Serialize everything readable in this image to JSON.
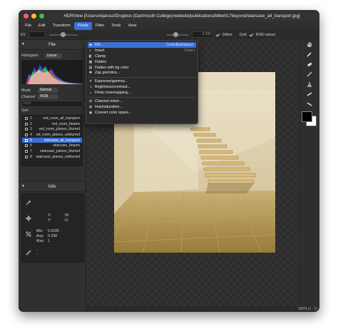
{
  "window": {
    "title": "HDRView [/Users/wjarosz/Dropbox (Dartmouth College)/website/publications/bitterli17beyond/staircase_all_transport.jpg]"
  },
  "menubar": [
    "File",
    "Edit",
    "Transform",
    "Pixels",
    "Filter",
    "Tools",
    "View"
  ],
  "toolbar": {
    "ev_label": "EV",
    "gamma_value": "2.200",
    "dither_label": "Dither",
    "grid_label": "Grid",
    "rgb_label": "RGB values"
  },
  "sidebar": {
    "file_header": "File",
    "histogram_label": "Histogram",
    "histogram_select": "Linear",
    "mode_label": "Mode",
    "mode_value": "Normal",
    "channel_label": "Channel",
    "channel_value": "RGB",
    "find_placeholder": "Find",
    "sort_label": "Sort",
    "images": [
      {
        "num": "1",
        "name": "red_room_all_transport"
      },
      {
        "num": "2",
        "name": "red_room_beams"
      },
      {
        "num": "3",
        "name": "red_room_planes_blurred"
      },
      {
        "num": "4",
        "name": "ed_room_planes_unblurred"
      },
      {
        "num": "5",
        "name": "staircase_all_transport"
      },
      {
        "num": "6",
        "name": "staircase_beams"
      },
      {
        "num": "7",
        "name": "staircase_planes_blurred"
      },
      {
        "num": "8",
        "name": "staircase_planes_unblurred"
      }
    ],
    "info_header": "Info",
    "info": {
      "x_label": "X:",
      "y_label": "Y:",
      "w_label": "W:",
      "h_label": "H:",
      "min_label": "Min:",
      "min_value": "0.0185",
      "avg_label": "Avg:",
      "avg_value": "0.338",
      "max_label": "Max:",
      "max_value": "1",
      "dash_label": "-"
    }
  },
  "pixels_menu": {
    "items": [
      {
        "label": "Fill...",
        "shortcut": "Cmd+Backspace",
        "icon": "fill-icon"
      },
      {
        "label": "Invert",
        "shortcut": "Cmd+I",
        "icon": "invert-icon"
      },
      {
        "label": "Clamp",
        "shortcut": "",
        "icon": "clamp-icon"
      },
      {
        "label": "Flatten",
        "shortcut": "",
        "icon": "flatten-icon"
      },
      {
        "label": "Flatten with bg color",
        "shortcut": "",
        "icon": "flatten-bg-icon"
      },
      {
        "label": "Zap gremlins...",
        "shortcut": "",
        "icon": "zap-icon"
      },
      {
        "label": "Exposure/gamma...",
        "shortcut": "",
        "icon": "exposure-icon"
      },
      {
        "label": "Brightness/contrast...",
        "shortcut": "",
        "icon": "brightness-icon"
      },
      {
        "label": "Filmic tonemapping...",
        "shortcut": "",
        "icon": "filmic-icon"
      },
      {
        "label": "Channel mixer...",
        "shortcut": "",
        "icon": "mixer-icon"
      },
      {
        "label": "Hue/saturation...",
        "shortcut": "",
        "icon": "hue-icon"
      },
      {
        "label": "Convert color space...",
        "shortcut": "",
        "icon": "convert-icon"
      }
    ]
  },
  "status": {
    "zoom": "100% (1 : 1)"
  },
  "colors": {
    "accent": "#3a6fd6",
    "window_bg": "#2a2a2a",
    "foreground_swatch": "#000000",
    "background_swatch": "#ffffff"
  }
}
